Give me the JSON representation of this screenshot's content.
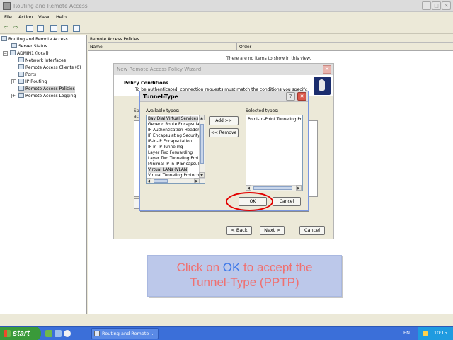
{
  "app": {
    "title": "Routing and Remote Access",
    "menu": [
      "File",
      "Action",
      "View",
      "Help"
    ]
  },
  "tree": {
    "items": [
      {
        "label": "Routing and Remote Access"
      },
      {
        "label": "Server Status"
      },
      {
        "label": "ADMIN1 (local)"
      },
      {
        "label": "Network Interfaces"
      },
      {
        "label": "Remote Access Clients (0)"
      },
      {
        "label": "Ports"
      },
      {
        "label": "IP Routing"
      },
      {
        "label": "Remote Access Policies"
      },
      {
        "label": "Remote Access Logging"
      }
    ]
  },
  "right": {
    "header": "Remote Access Policies",
    "columns": [
      "Name",
      "Order"
    ],
    "empty_message": "There are no items to show in this view."
  },
  "wizard": {
    "title": "New Remote Access Policy Wizard",
    "heading": "Policy Conditions",
    "description": "To be authenticated, connection requests must match the conditions you specify.",
    "fragments": [
      "Sp",
      "acc",
      "Po"
    ],
    "back_label": "< Back",
    "next_label": "Next >",
    "cancel_label": "Cancel"
  },
  "tunnel_dialog": {
    "title": "Tunnel-Type",
    "available_label": "Available types:",
    "selected_label": "Selected types:",
    "available_types": [
      "Bay Dial Virtual Services",
      "Generic Route Encapsulation",
      "IP Authentication Header",
      "IP Encapsulating Security",
      "IP-in-IP Encapsulation",
      "IP-in-IP Tunneling",
      "Layer Two Forwarding",
      "Layer Two Tunneling Protocol",
      "Minimal IP-in-IP Encapsulation",
      "Virtual LANs (VLAN)",
      "Virtual Tunneling Protocol"
    ],
    "selected_types": [
      "Point-to-Point Tunneling Protocol"
    ],
    "add_label": "Add >>",
    "remove_label": "<< Remove",
    "ok_label": "OK",
    "cancel_label": "Cancel"
  },
  "caption": {
    "part1": "Click on ",
    "highlight": "OK",
    "part2": " to accept the",
    "line2": "Tunnel-Type (PPTP)"
  },
  "taskbar": {
    "start_label": "start",
    "task_label": "Routing and Remote ...",
    "language": "EN",
    "clock": "10:15"
  },
  "colors": {
    "highlight_ring": "#e20000",
    "caption_text": "#f07070",
    "caption_highlight": "#3f79e8",
    "caption_bg": "#bcc8ea"
  }
}
